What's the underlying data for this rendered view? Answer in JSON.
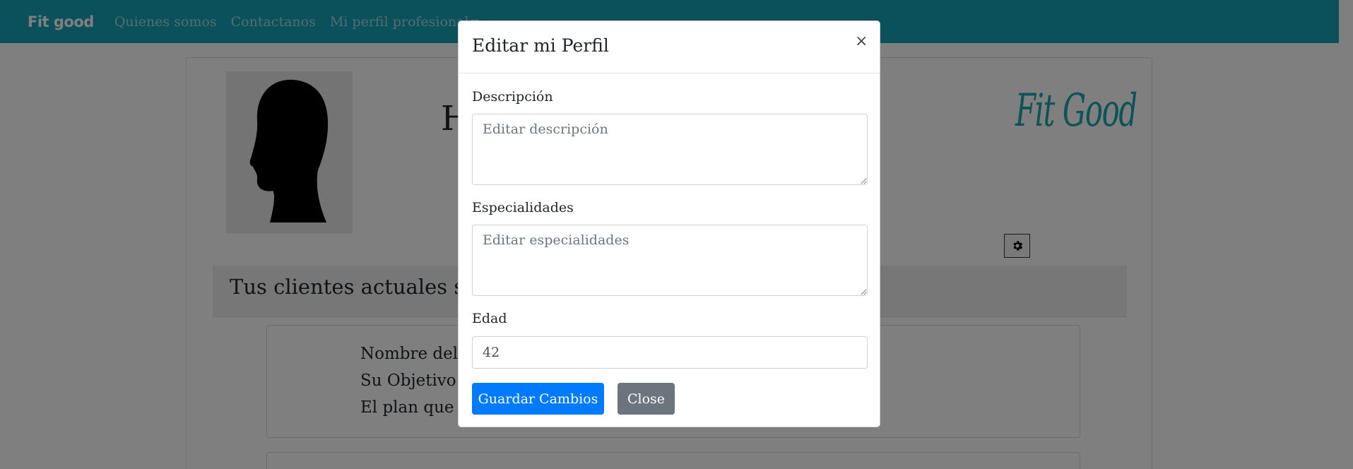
{
  "navbar": {
    "brand": "Fit good",
    "links": [
      "Quienes somos",
      "Contactanos",
      "Mi perfil profesional"
    ],
    "color": "#17a2b8"
  },
  "page": {
    "heading": "H",
    "logo_text": "Fit Good",
    "clients_title": "Tus clientes actuales son",
    "client_lines": [
      "Nombre del",
      "Su Objetivo e",
      "El plan que e"
    ],
    "settings_icon": "gear-icon"
  },
  "modal": {
    "title": "Editar mi Perfil",
    "close_symbol": "×",
    "fields": {
      "descripcion": {
        "label": "Descripción",
        "placeholder": "Editar descripción",
        "value": ""
      },
      "especialidades": {
        "label": "Especialidades",
        "placeholder": "Editar especialidades",
        "value": ""
      },
      "edad": {
        "label": "Edad",
        "value": "42"
      }
    },
    "save_label": "Guardar Cambios",
    "close_label": "Close",
    "colors": {
      "primary": "#007bff",
      "secondary": "#6c757d"
    }
  }
}
